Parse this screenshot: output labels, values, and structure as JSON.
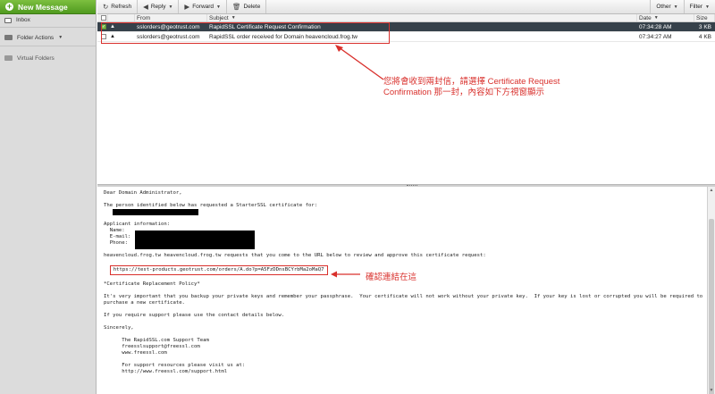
{
  "sidebar": {
    "new_message": "New Message",
    "inbox": "Inbox",
    "folder_actions": "Folder Actions",
    "virtual_folders": "Virtual Folders"
  },
  "toolbar": {
    "refresh": "Refresh",
    "reply": "Reply",
    "forward": "Forward",
    "delete": "Delete",
    "other": "Other",
    "filter": "Filter"
  },
  "list": {
    "headers": {
      "from": "From",
      "subject": "Subject",
      "date": "Date",
      "size": "Size"
    },
    "rows": [
      {
        "from": "sslorders@geotrust.com",
        "subject": "RapidSSL Certificate Request Confirmation",
        "date": "07:34:28 AM",
        "size": "3 KB",
        "selected": true
      },
      {
        "from": "sslorders@geotrust.com",
        "subject": "RapidSSL order received for Domain heavencloud.frog.tw",
        "date": "07:34:27 AM",
        "size": "4 KB",
        "selected": false
      }
    ]
  },
  "annotation_top": "您將會收到兩封信，請選擇 Certificate Request Confirmation 那一封，內容如下方視窗顯示",
  "annotation_url": "確認連結在這",
  "preview": {
    "greeting": "Dear Domain Administrator,",
    "line_person": "The person identified below has requested a StarterSSL certificate for:",
    "applicant_header": "Applicant information:",
    "label_name": "  Name:",
    "label_email": "  E-mail:",
    "label_phone": "  Phone:",
    "request_line": "heavencloud.frog.tw heavencloud.frog.tw requests that you come to the URL below to review and approve this certificate request:",
    "url": "https://test-products.geotrust.com/orders/A.do?p=A5FzDDnsBCYrbMa2oMaQ7",
    "policy": "*Certificate Replacement Policy*",
    "important1": "It's very important that you backup your private keys and remember your passphrase.  Your certificate will not work without your private key.  If your key is lost or corrupted you will be required to",
    "important2": "purchase a new certificate.",
    "support": "If you require support please use the contact details below.",
    "sincerely": "Sincerely,",
    "team": "      The RapidSSL.com Support Team",
    "email": "      freesslsupport@freessl.com",
    "web": "      www.freessl.com",
    "resources": "      For support resources please visit us at:",
    "resources_url": "      http://www.freessl.com/support.html"
  }
}
